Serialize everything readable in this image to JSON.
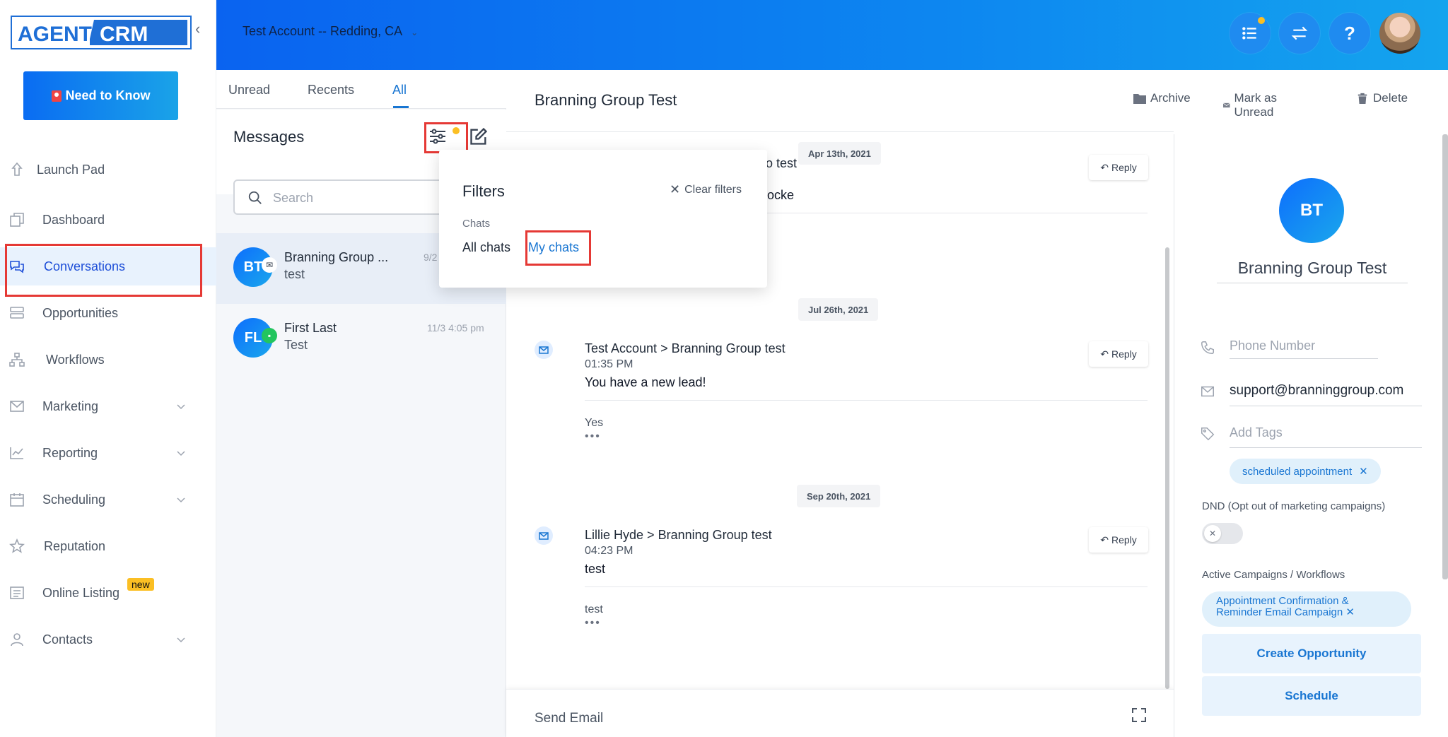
{
  "brand": {
    "logo_left": "AGENT",
    "logo_right": "CRM"
  },
  "sidebar": {
    "need_to_know": "Need to Know",
    "items": [
      {
        "label": "Launch Pad"
      },
      {
        "label": "Dashboard"
      },
      {
        "label": "Conversations"
      },
      {
        "label": "Opportunities"
      },
      {
        "label": "Workflows"
      },
      {
        "label": "Marketing"
      },
      {
        "label": "Reporting"
      },
      {
        "label": "Scheduling"
      },
      {
        "label": "Reputation"
      },
      {
        "label": "Online Listing"
      },
      {
        "label": "Contacts"
      }
    ],
    "new_badge": "new"
  },
  "header": {
    "account": "Test Account -- Redding, CA"
  },
  "list": {
    "tabs": [
      "Unread",
      "Recents",
      "All"
    ],
    "title": "Messages",
    "search_placeholder": "Search",
    "conversations": [
      {
        "initials": "BT",
        "name": "Branning Group ...",
        "preview": "test",
        "time": "9/2"
      },
      {
        "initials": "FL",
        "name": "First Last",
        "preview": "Test",
        "time": "11/3 4:05 pm"
      }
    ]
  },
  "filters": {
    "title": "Filters",
    "clear": "Clear filters",
    "section": "Chats",
    "option_all": "All chats",
    "option_mine": "My chats"
  },
  "thread": {
    "title": "Branning Group Test",
    "actions": {
      "archive": "Archive",
      "mark_unread": "Mark as Unread",
      "delete": "Delete"
    },
    "partial_text_1": "o test",
    "partial_text_2": "ocke",
    "reply": "Reply",
    "messages": [
      {
        "date": "Apr 13th, 2021"
      },
      {
        "date": "Jul 26th, 2021",
        "from": "Test Account",
        "to": "Branning Group test",
        "time": "01:35 PM",
        "body": "You have a new lead!",
        "quote": "Yes"
      },
      {
        "date": "Sep 20th, 2021",
        "from": "Lillie Hyde",
        "to": "Branning Group test",
        "time": "04:23 PM",
        "body": "test",
        "quote": "test"
      }
    ],
    "send_label": "Send Email"
  },
  "contact": {
    "initials": "BT",
    "name": "Branning Group Test",
    "phone_placeholder": "Phone Number",
    "email": "support@branninggroup.com",
    "tags_placeholder": "Add Tags",
    "tags": [
      "scheduled appointment"
    ],
    "dnd_label": "DND (Opt out of marketing campaigns)",
    "campaigns_label": "Active Campaigns / Workflows",
    "campaign_line1": "Appointment Confirmation &",
    "campaign_line2": "Reminder Email Campaign",
    "create_opportunity": "Create Opportunity",
    "schedule": "Schedule"
  }
}
